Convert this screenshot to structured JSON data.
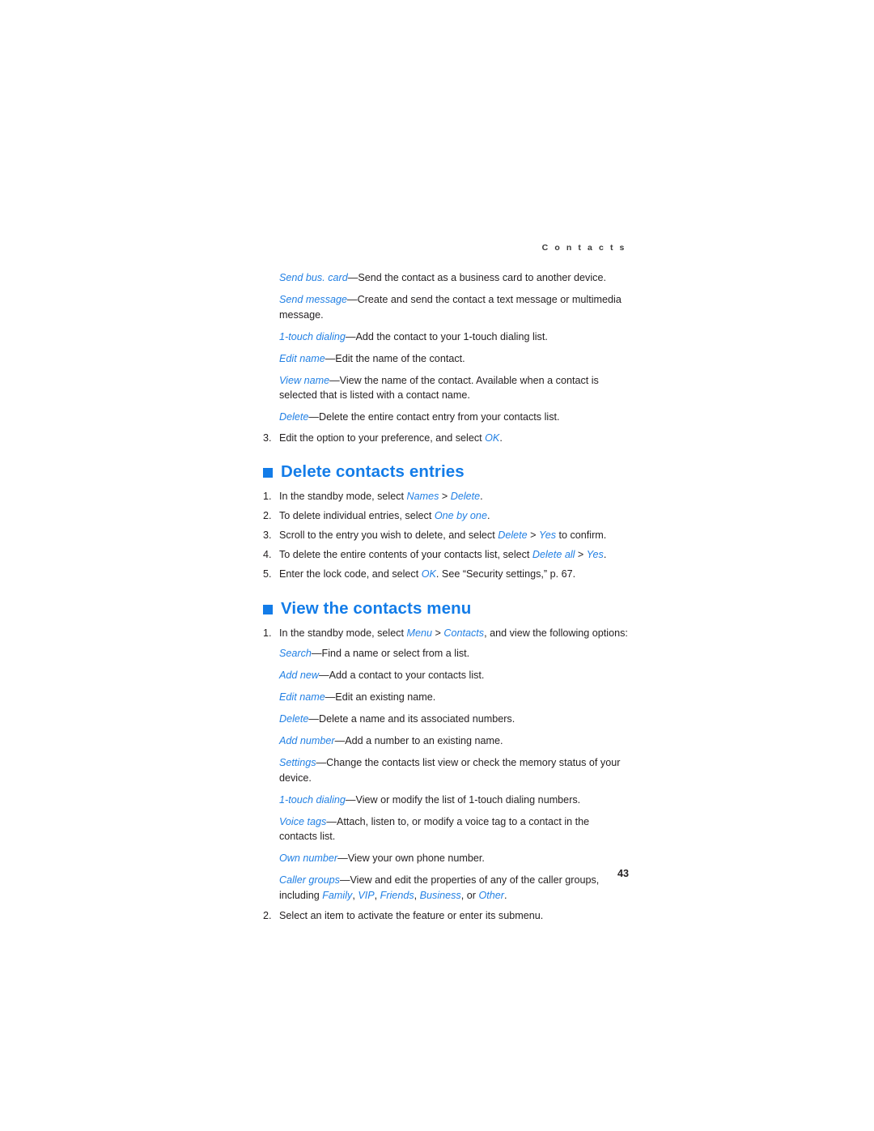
{
  "document": {
    "running_head": "C o n t a c t s",
    "page_number": "43",
    "accent_color": "#137ce8",
    "term_color": "#2280e4",
    "body_color": "#231f20"
  },
  "intro_options": [
    {
      "term": "Send bus. card",
      "dash": "—",
      "desc": "Send the contact as a business card to another device."
    },
    {
      "term": "Send message",
      "dash": "—",
      "desc": "Create and send the contact a text message or multimedia message."
    },
    {
      "term": "1-touch dialing",
      "dash": "—",
      "desc": "Add the contact to your 1-touch dialing list."
    },
    {
      "term": "Edit name",
      "dash": "—",
      "desc": "Edit the name of the contact."
    },
    {
      "term": "View name",
      "dash": "—",
      "desc": "View the name of the contact. Available when a contact is selected that is listed with a contact name."
    },
    {
      "term": "Delete",
      "dash": "—",
      "desc": "Delete the entire contact entry from your contacts list."
    }
  ],
  "intro_step": {
    "num": "3.",
    "pre": "Edit the option to your preference, and select ",
    "term": "OK",
    "post": "."
  },
  "section_delete": {
    "heading": "Delete contacts entries",
    "steps": [
      {
        "num": "1.",
        "parts": [
          {
            "type": "plain",
            "text": "In the standby mode, select "
          },
          {
            "type": "term",
            "text": "Names"
          },
          {
            "type": "plain",
            "text": " > "
          },
          {
            "type": "term",
            "text": "Delete"
          },
          {
            "type": "plain",
            "text": "."
          }
        ]
      },
      {
        "num": "2.",
        "parts": [
          {
            "type": "plain",
            "text": "To delete individual entries, select "
          },
          {
            "type": "term",
            "text": "One by one"
          },
          {
            "type": "plain",
            "text": "."
          }
        ]
      },
      {
        "num": "3.",
        "parts": [
          {
            "type": "plain",
            "text": "Scroll to the entry you wish to delete, and select "
          },
          {
            "type": "term",
            "text": "Delete"
          },
          {
            "type": "plain",
            "text": " > "
          },
          {
            "type": "term",
            "text": "Yes"
          },
          {
            "type": "plain",
            "text": " to confirm."
          }
        ]
      },
      {
        "num": "4.",
        "parts": [
          {
            "type": "plain",
            "text": "To delete the entire contents of your contacts list, select "
          },
          {
            "type": "term",
            "text": "Delete all"
          },
          {
            "type": "plain",
            "text": " > "
          },
          {
            "type": "term",
            "text": "Yes"
          },
          {
            "type": "plain",
            "text": "."
          }
        ]
      },
      {
        "num": "5.",
        "parts": [
          {
            "type": "plain",
            "text": "Enter the lock code, and select "
          },
          {
            "type": "term",
            "text": "OK"
          },
          {
            "type": "plain",
            "text": ". See “Security settings,” p. 67."
          }
        ]
      }
    ]
  },
  "section_view": {
    "heading": "View the contacts menu",
    "step_one": {
      "num": "1.",
      "parts": [
        {
          "type": "plain",
          "text": "In the standby mode, select "
        },
        {
          "type": "term",
          "text": "Menu"
        },
        {
          "type": "plain",
          "text": " > "
        },
        {
          "type": "term",
          "text": "Contacts"
        },
        {
          "type": "plain",
          "text": ", and view the following options:"
        }
      ]
    },
    "options": [
      {
        "term": "Search",
        "dash": "—",
        "desc": "Find a name or select from a list."
      },
      {
        "term": "Add new",
        "dash": "—",
        "desc": "Add a contact to your contacts list."
      },
      {
        "term": "Edit name",
        "dash": "—",
        "desc": "Edit an existing name."
      },
      {
        "term": "Delete",
        "dash": "—",
        "desc": "Delete a name and its associated numbers."
      },
      {
        "term": "Add number",
        "dash": "—",
        "desc": "Add a number to an existing name."
      },
      {
        "term": "Settings",
        "dash": "—",
        "desc": "Change the contacts list view or check the memory status of your device."
      },
      {
        "term": "1-touch dialing",
        "dash": "—",
        "desc": "View or modify the list of 1-touch dialing numbers."
      },
      {
        "term": "Voice tags",
        "dash": "—",
        "desc": "Attach, listen to, or modify a voice tag to a contact in the contacts list."
      },
      {
        "term": "Own number",
        "dash": "—",
        "desc": "View your own phone number."
      }
    ],
    "caller_groups": {
      "term": "Caller groups",
      "dash": "—",
      "desc_pre": "View and edit the properties of any of the caller groups, including ",
      "groups": [
        "Family",
        "VIP",
        "Friends",
        "Business",
        "Other"
      ],
      "comma": ", ",
      "conjunction": ", or ",
      "desc_post": "."
    },
    "step_two": {
      "num": "2.",
      "parts": [
        {
          "type": "plain",
          "text": "Select an item to activate the feature or enter its submenu."
        }
      ]
    }
  }
}
